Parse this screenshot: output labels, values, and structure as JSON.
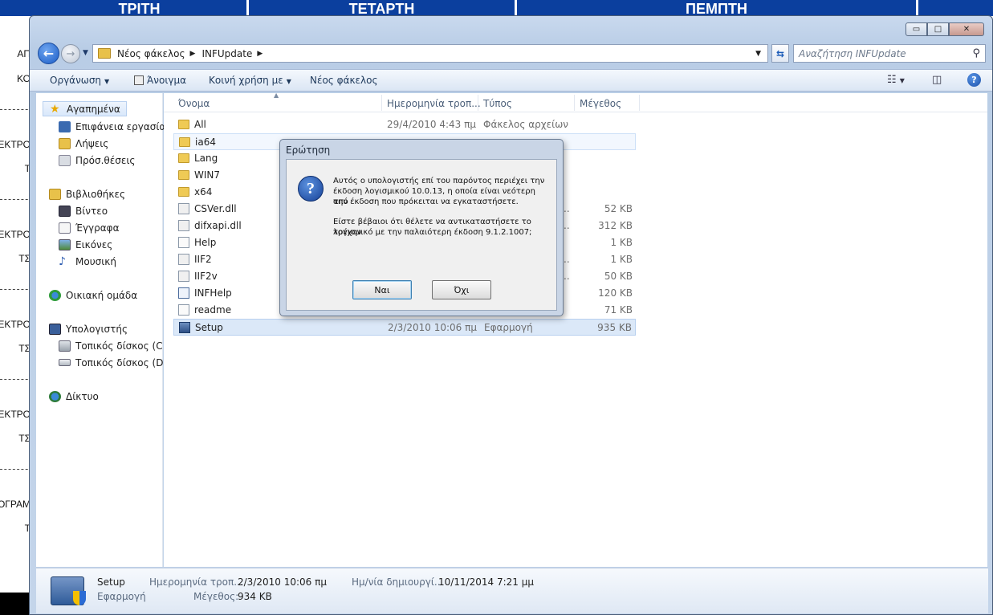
{
  "background": {
    "days": [
      "ΤΡΙΤΗ",
      "ΤΕΤΑΡΤΗ",
      "ΠΕΜΠΤΗ"
    ],
    "left_labels": [
      "ΑΠ",
      "ΚΟ",
      "ΕΚΤΡΟ",
      "Τ",
      "ΕΚΤΡΟ",
      "ΤΣ",
      "ΕΚΤΡΟ",
      "ΤΣ",
      "ΕΚΤΡΟ",
      "ΤΣ",
      "ΟΓΡΑΜ",
      "Τ"
    ]
  },
  "window": {
    "caption_buttons": {
      "minimize": "▭",
      "maximize": "□",
      "close": "✕"
    },
    "address": {
      "crumbs": [
        "Νέος φάκελος",
        "INFUpdate"
      ],
      "separator": "▶"
    },
    "search_placeholder": "Αναζήτηση INFUpdate",
    "toolbar": {
      "organize": "Οργάνωση",
      "open": "Άνοιγμα",
      "share": "Κοινή χρήση με",
      "new_folder": "Νέος φάκελος"
    },
    "navigation": {
      "favorites": "Αγαπημένα",
      "desktop": "Επιφάνεια εργασίας",
      "downloads": "Λήψεις",
      "recent": "Πρόσ.θέσεις",
      "libraries": "Βιβλιοθήκες",
      "videos": "Βίντεο",
      "documents": "Έγγραφα",
      "pictures": "Εικόνες",
      "music": "Μουσική",
      "homegroup": "Οικιακή ομάδα",
      "computer": "Υπολογιστής",
      "disk_c": "Τοπικός δίσκος (C:)",
      "disk_d": "Τοπικός δίσκος (D:)",
      "network": "Δίκτυο"
    },
    "columns": {
      "name": "Όνομα",
      "date": "Ημερομηνία τροπ...",
      "type": "Τύπος",
      "size": "Μέγεθος"
    },
    "files": [
      {
        "name": "All",
        "date": "29/4/2010 4:43 πμ",
        "type": "Φάκελος αρχείων",
        "size": ""
      },
      {
        "name": "ia64",
        "date": "",
        "type": "",
        "size": ""
      },
      {
        "name": "Lang",
        "date": "",
        "type": "",
        "size": ""
      },
      {
        "name": "WIN7",
        "date": "",
        "type": "",
        "size": ""
      },
      {
        "name": "x64",
        "date": "",
        "type": "",
        "size": ""
      },
      {
        "name": "CSVer.dll",
        "date": "",
        "type": "",
        "size": "52 KB"
      },
      {
        "name": "difxapi.dll",
        "date": "",
        "type": "",
        "size": "312 KB"
      },
      {
        "name": "Help",
        "date": "",
        "type": "",
        "size": "1 KB"
      },
      {
        "name": "IIF2",
        "date": "",
        "type": "",
        "size": "1 KB"
      },
      {
        "name": "IIF2v",
        "date": "",
        "type": "",
        "size": "50 KB"
      },
      {
        "name": "INFHelp",
        "date": "",
        "type": "",
        "size": "120 KB"
      },
      {
        "name": "readme",
        "date": "",
        "type": "",
        "size": "71 KB"
      },
      {
        "name": "Setup",
        "date": "2/3/2010 10:06 πμ",
        "type": "Εφαρμογή",
        "size": "935 KB"
      }
    ],
    "truncation": "..",
    "details": {
      "name": "Setup",
      "type": "Εφαρμογή",
      "modified_label": "Ημερομηνία τροπ...",
      "modified_value": "2/3/2010 10:06 πμ",
      "size_label": "Μέγεθος:",
      "size_value": "934 KB",
      "created_label": "Ημ/νία δημιουργί...",
      "created_value": "10/11/2014 7:21 μμ"
    }
  },
  "dialog": {
    "title": "Ερώτηση",
    "line1": "Αυτός ο υπολογιστής επί του παρόντος περιέχει την",
    "line2": "έκδοση λογισμικού 10.0.13, η οποία είναι νεότερη από",
    "line3": "την έκδοση που πρόκειται να εγκαταστήσετε.",
    "line4": "Είστε βέβαιοι ότι θέλετε να αντικαταστήσετε το τρέχον",
    "line5": "λογισμικό με την παλαιότερη έκδοση 9.1.2.1007;",
    "yes": "Ναι",
    "no": "Όχι"
  }
}
